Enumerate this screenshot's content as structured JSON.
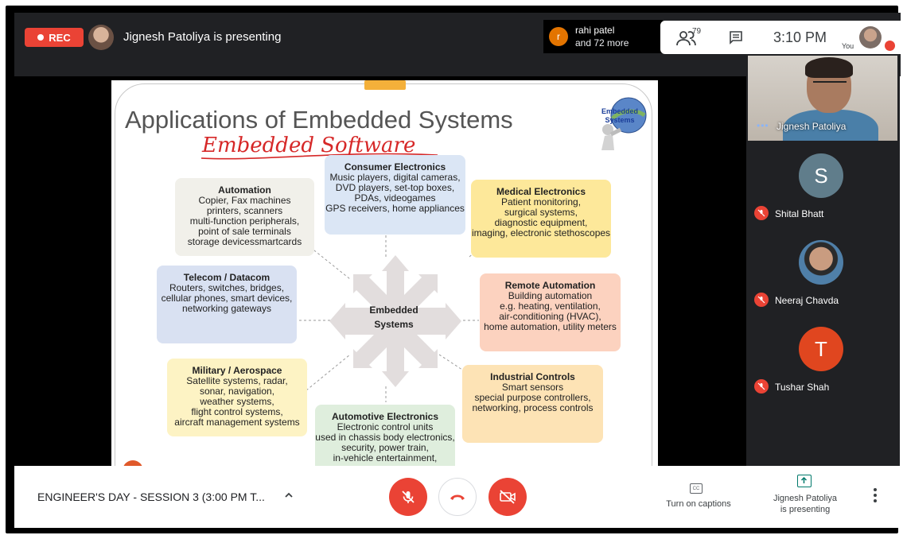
{
  "topbar": {
    "rec_label": "REC",
    "presenting_text": "Jignesh Patoliya is presenting",
    "others_initial": "r",
    "others_name": "rahi patel",
    "others_more": "and 72 more",
    "people_count": "79",
    "time": "3:10 PM",
    "you_label": "You"
  },
  "slide": {
    "title": "Applications of Embedded Systems",
    "handwriting": "Embedded Software",
    "logo_text": "Embedded Systems",
    "center_label": "Embedded\nSystems",
    "boxes": [
      {
        "title": "Consumer Electronics",
        "body": "Music players,  digital cameras,\nDVD players, set-top boxes,\nPDAs, videogames\nGPS receivers, home appliances",
        "color": "#dbe6f5"
      },
      {
        "title": "Automation",
        "body": "Copier, Fax machines\nprinters, scanners\nmulti-function peripherals,\npoint of sale terminals\nstorage devicessmartcards",
        "color": "#f1f0ea"
      },
      {
        "title": "Medical Electronics",
        "body": "Patient monitoring,\nsurgical systems,\ndiagnostic equipment,\nimaging, electronic stethoscopes",
        "color": "#fde89a"
      },
      {
        "title": "Telecom / Datacom",
        "body": "Routers, switches, bridges,\ncellular phones, smart devices,\nnetworking gateways",
        "color": "#d9e1f2"
      },
      {
        "title": "Remote Automation",
        "body": "Building automation\ne.g. heating, ventilation,\nair-conditioning (HVAC),\nhome automation, utility meters",
        "color": "#fcd2bf"
      },
      {
        "title": "Military / Aerospace",
        "body": "Satellite systems, radar,\nsonar, navigation,\nweather systems,\nflight control systems,\naircraft management systems",
        "color": "#fdf3c4"
      },
      {
        "title": "Industrial Controls",
        "body": "Smart sensors\nspecial purpose controllers,\nnetworking, process controls",
        "color": "#fde3b5"
      },
      {
        "title": "Automotive Electronics",
        "body": "Electronic control units\nused in chassis body electronics,\nsecurity, power train,\nin-vehicle entertainment,",
        "color": "#dfeedd"
      }
    ]
  },
  "participants": {
    "presenter_tile_name": "Jignesh Patoliya",
    "list": [
      {
        "initial": "S",
        "name": "Shital Bhatt",
        "color": "#607d8b"
      },
      {
        "initial": "",
        "name": "Neeraj Chavda",
        "color": "#4f7fa8"
      },
      {
        "initial": "T",
        "name": "Tushar Shah",
        "color": "#e0461f"
      }
    ]
  },
  "bottombar": {
    "meeting_title": "ENGINEER'S DAY - SESSION 3 (3:00 PM T...",
    "captions_icon_text": "CC",
    "captions_label": "Turn on captions",
    "present_label": "Jignesh Patoliya\nis presenting"
  },
  "colors": {
    "accent_red": "#ea4335",
    "bar_dark": "#202124",
    "present_green": "#00796b"
  }
}
